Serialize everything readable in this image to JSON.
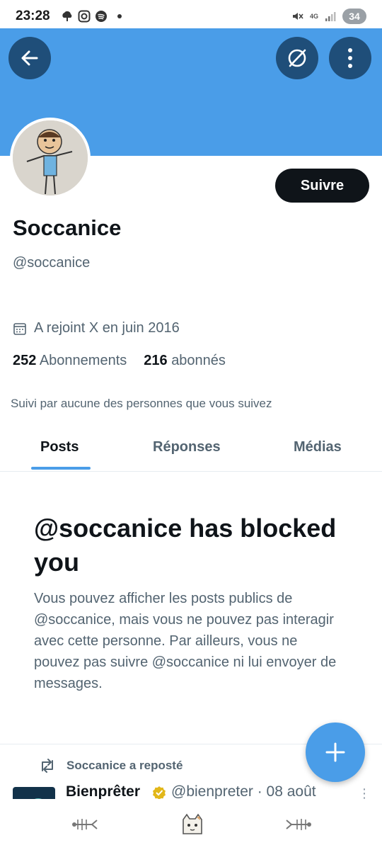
{
  "status_bar": {
    "time": "23:28",
    "network": "4G",
    "battery": "34",
    "icons_left": [
      "weather-icon",
      "instagram-icon",
      "spotify-icon",
      "notification-dot"
    ],
    "icons_right": [
      "mute-icon",
      "signal-icon",
      "battery-icon"
    ]
  },
  "header": {
    "banner_color": "#4a9de8",
    "back_icon": "arrow-left-icon",
    "grok_icon": "grok-icon",
    "more_icon": "more-vertical-icon"
  },
  "profile": {
    "display_name": "Soccanice",
    "handle": "@soccanice",
    "joined": "A rejoint X en juin 2016",
    "following_count": "252",
    "following_label": "Abonnements",
    "followers_count": "216",
    "followers_label": "abonnés",
    "followed_by": "Suivi par aucune des personnes que vous suivez",
    "follow_label": "Suivre"
  },
  "tabs": [
    {
      "label": "Posts",
      "active": true
    },
    {
      "label": "Réponses",
      "active": false
    },
    {
      "label": "Médias",
      "active": false
    }
  ],
  "blocked": {
    "title": "@soccanice has blocked you",
    "body": "Vous pouvez afficher les posts publics de @soccanice, mais vous ne pouvez pas interagir avec cette personne. Par ailleurs, vous ne pouvez pas suivre @soccanice ni lui envoyer de messages."
  },
  "feed": {
    "repost_label": "Soccanice a reposté",
    "post_name": "Bienprêter",
    "post_meta": "@bienpreter · 08 août",
    "verified_color": "#e2b719"
  },
  "colors": {
    "accent": "#4a9de8",
    "dark_button": "#1f4e79",
    "text_primary": "#0f1419",
    "text_secondary": "#536471"
  },
  "bottom_nav": [
    "fish-bone-icon",
    "cat-icon",
    "fish-bone-icon"
  ]
}
